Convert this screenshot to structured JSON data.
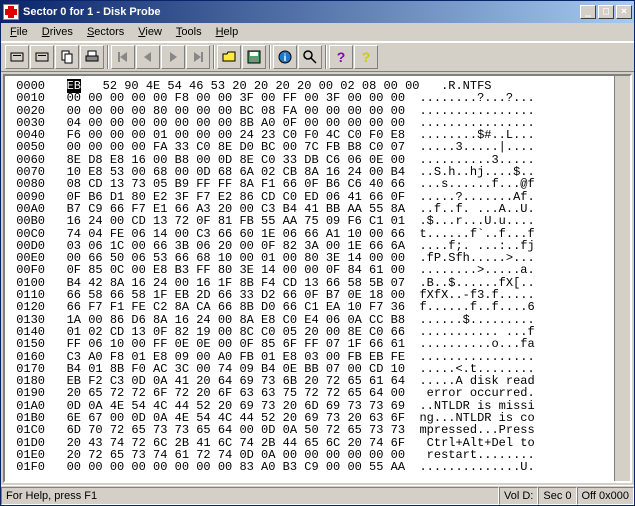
{
  "window": {
    "title": "Sector 0 for 1 - Disk Probe"
  },
  "menu": {
    "file": "File",
    "drives": "Drives",
    "sectors": "Sectors",
    "view": "View",
    "tools": "Tools",
    "help": "Help"
  },
  "status": {
    "help": "For Help, press F1",
    "vol": "Vol D:",
    "sec": "Sec 0",
    "off": "Off 0x000"
  },
  "hex": {
    "highlight": "EB",
    "rows": [
      {
        "o": "0000",
        "h": "   52 90 4E 54 46 53 20 20 20 20 00 02 08 00 00",
        "a": "  .R.NTFS"
      },
      {
        "o": "0010",
        "h": "00 00 00 00 00 F8 00 00 3F 00 FF 00 3F 00 00 00",
        "a": " ........?...?..."
      },
      {
        "o": "0020",
        "h": "00 00 00 00 80 00 00 00 BC 08 FA 00 00 00 00 00",
        "a": " ................"
      },
      {
        "o": "0030",
        "h": "04 00 00 00 00 00 00 00 8B A0 0F 00 00 00 00 00",
        "a": " ................"
      },
      {
        "o": "0040",
        "h": "F6 00 00 00 01 00 00 00 24 23 C0 F0 4C C0 F0 E8",
        "a": " ........$#..L..."
      },
      {
        "o": "0050",
        "h": "00 00 00 00 FA 33 C0 8E D0 BC 00 7C FB B8 C0 07",
        "a": " .....3.....|...."
      },
      {
        "o": "0060",
        "h": "8E D8 E8 16 00 B8 00 0D 8E C0 33 DB C6 06 0E 00",
        "a": " ..........3....."
      },
      {
        "o": "0070",
        "h": "10 E8 53 00 68 00 0D 68 6A 02 CB 8A 16 24 00 B4",
        "a": " ..S.h..hj....$.."
      },
      {
        "o": "0080",
        "h": "08 CD 13 73 05 B9 FF FF 8A F1 66 0F B6 C6 40 66",
        "a": " ...s......f...@f"
      },
      {
        "o": "0090",
        "h": "0F B6 D1 80 E2 3F F7 E2 86 CD C0 ED 06 41 66 0F",
        "a": " .....?.......Af."
      },
      {
        "o": "00A0",
        "h": "B7 C9 66 F7 E1 66 A3 20 00 C3 B4 41 BB AA 55 8A",
        "a": " ..f..f. ...A..U."
      },
      {
        "o": "00B0",
        "h": "16 24 00 CD 13 72 0F 81 FB 55 AA 75 09 F6 C1 01",
        "a": " .$...r...U.u...."
      },
      {
        "o": "00C0",
        "h": "74 04 FE 06 14 00 C3 66 60 1E 06 66 A1 10 00 66",
        "a": " t......f`..f...f"
      },
      {
        "o": "00D0",
        "h": "03 06 1C 00 66 3B 06 20 00 0F 82 3A 00 1E 66 6A",
        "a": " ....f;. ...:..fj"
      },
      {
        "o": "00E0",
        "h": "00 66 50 06 53 66 68 10 00 01 00 80 3E 14 00 00",
        "a": " .fP.Sfh.....>..."
      },
      {
        "o": "00F0",
        "h": "0F 85 0C 00 E8 B3 FF 80 3E 14 00 00 0F 84 61 00",
        "a": " ........>.....a."
      },
      {
        "o": "0100",
        "h": "B4 42 8A 16 24 00 16 1F 8B F4 CD 13 66 58 5B 07",
        "a": " .B..$......fX[.."
      },
      {
        "o": "0110",
        "h": "66 58 66 58 1F EB 2D 66 33 D2 66 0F B7 0E 18 00",
        "a": " fXfX..-f3.f....."
      },
      {
        "o": "0120",
        "h": "66 F7 F1 FE C2 8A CA 66 8B D0 66 C1 EA 10 F7 36",
        "a": " f......f..f....6"
      },
      {
        "o": "0130",
        "h": "1A 00 86 D6 8A 16 24 00 8A E8 C0 E4 06 0A CC B8",
        "a": " ......$........."
      },
      {
        "o": "0140",
        "h": "01 02 CD 13 0F 82 19 00 8C C0 05 20 00 8E C0 66",
        "a": " ........... ...f"
      },
      {
        "o": "0150",
        "h": "FF 06 10 00 FF 0E 0E 00 0F 85 6F FF 07 1F 66 61",
        "a": " ..........o...fa"
      },
      {
        "o": "0160",
        "h": "C3 A0 F8 01 E8 09 00 A0 FB 01 E8 03 00 FB EB FE",
        "a": " ................"
      },
      {
        "o": "0170",
        "h": "B4 01 8B F0 AC 3C 00 74 09 B4 0E BB 07 00 CD 10",
        "a": " .....<.t........"
      },
      {
        "o": "0180",
        "h": "EB F2 C3 0D 0A 41 20 64 69 73 6B 20 72 65 61 64",
        "a": " .....A disk read"
      },
      {
        "o": "0190",
        "h": "20 65 72 72 6F 72 20 6F 63 63 75 72 72 65 64 00",
        "a": "  error occurred."
      },
      {
        "o": "01A0",
        "h": "0D 0A 4E 54 4C 44 52 20 69 73 20 6D 69 73 73 69",
        "a": " ..NTLDR is missi"
      },
      {
        "o": "01B0",
        "h": "6E 67 00 0D 0A 4E 54 4C 44 52 20 69 73 20 63 6F",
        "a": " ng...NTLDR is co"
      },
      {
        "o": "01C0",
        "h": "6D 70 72 65 73 73 65 64 00 0D 0A 50 72 65 73 73",
        "a": " mpressed...Press"
      },
      {
        "o": "01D0",
        "h": "20 43 74 72 6C 2B 41 6C 74 2B 44 65 6C 20 74 6F",
        "a": "  Ctrl+Alt+Del to"
      },
      {
        "o": "01E0",
        "h": "20 72 65 73 74 61 72 74 0D 0A 00 00 00 00 00 00",
        "a": "  restart........"
      },
      {
        "o": "01F0",
        "h": "00 00 00 00 00 00 00 00 83 A0 B3 C9 00 00 55 AA",
        "a": " ..............U."
      }
    ]
  }
}
